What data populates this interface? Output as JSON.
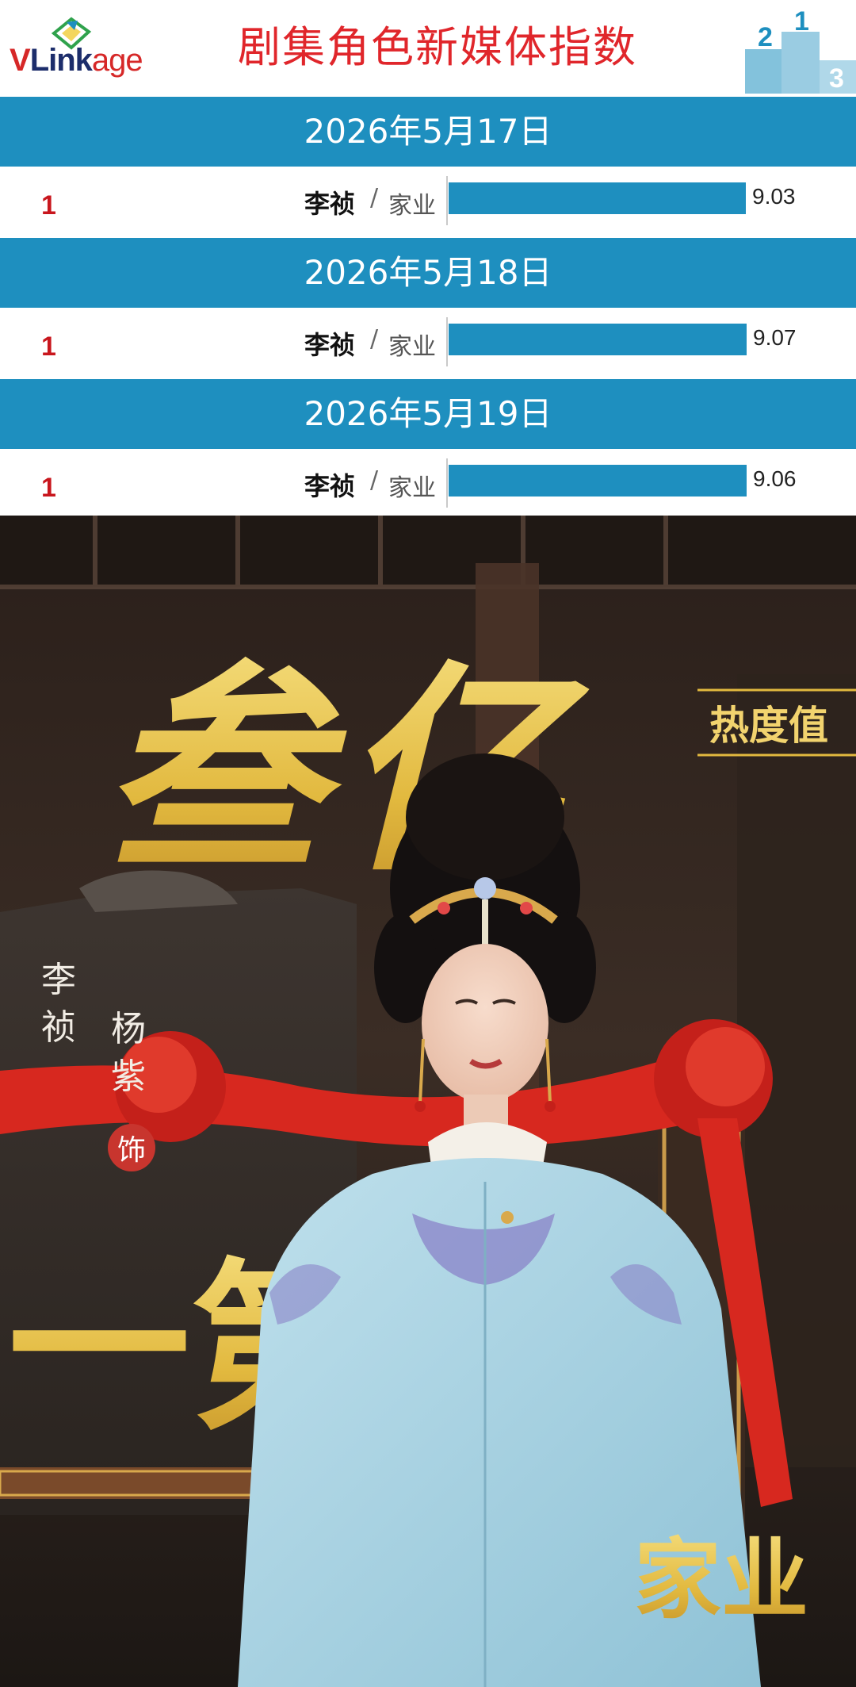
{
  "header": {
    "logo": {
      "v": "V",
      "link": "Link",
      "age": "age"
    },
    "title": "剧集角色新媒体指数",
    "podium_numbers": [
      "2",
      "1",
      "3"
    ]
  },
  "chart_data": {
    "type": "bar",
    "title": "剧集角色新媒体指数",
    "xlim": [
      0,
      10
    ],
    "entries": [
      {
        "date": "2026年5月17日",
        "rank": "1",
        "name": "李祯",
        "drama": "家业",
        "value": 9.03,
        "value_label": "9.03"
      },
      {
        "date": "2026年5月18日",
        "rank": "1",
        "name": "李祯",
        "drama": "家业",
        "value": 9.07,
        "value_label": "9.07"
      },
      {
        "date": "2026年5月19日",
        "rank": "1",
        "name": "李祯",
        "drama": "家业",
        "value": 9.06,
        "value_label": "9.06"
      }
    ],
    "separator": "/"
  },
  "poster": {
    "headline": "叁亿",
    "headline_sub": "热度值",
    "role_name": [
      "李",
      "祯"
    ],
    "actor_name": [
      "杨",
      "紫"
    ],
    "role_suffix": "饰",
    "plaque_text": "一第",
    "drama_title": "家业"
  },
  "colors": {
    "band": "#1e8fbf",
    "title_red": "#e0262b",
    "gold": "#e7c251",
    "robe": "#a9d4e3"
  }
}
